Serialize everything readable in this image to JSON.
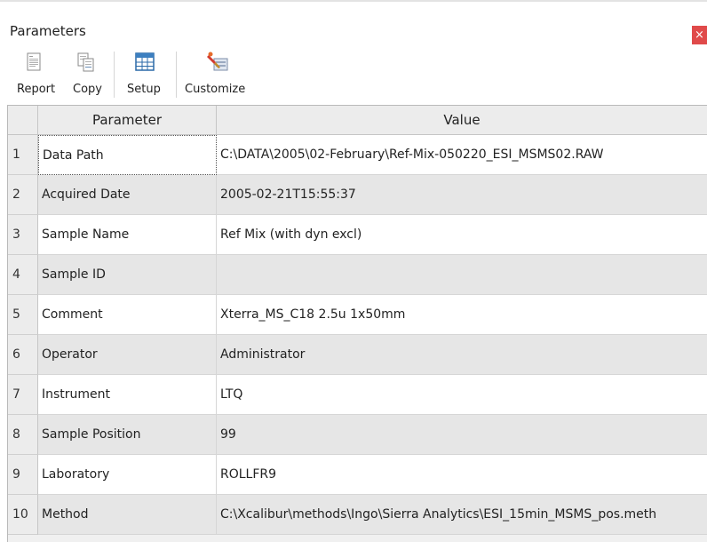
{
  "window": {
    "title": "Parameters",
    "close_label": "×"
  },
  "toolbar": {
    "items": [
      {
        "label": "Report",
        "icon": "report-icon"
      },
      {
        "label": "Copy",
        "icon": "copy-icon"
      },
      {
        "label": "Setup",
        "icon": "setup-icon"
      },
      {
        "label": "Customize",
        "icon": "customize-icon"
      }
    ]
  },
  "table": {
    "headers": {
      "parameter": "Parameter",
      "value": "Value"
    },
    "rows": [
      {
        "num": "1",
        "parameter": "Data Path",
        "value": "C:\\DATA\\2005\\02-February\\Ref-Mix-050220_ESI_MSMS02.RAW"
      },
      {
        "num": "2",
        "parameter": "Acquired Date",
        "value": "2005-02-21T15:55:37"
      },
      {
        "num": "3",
        "parameter": "Sample Name",
        "value": "Ref Mix (with dyn excl)"
      },
      {
        "num": "4",
        "parameter": "Sample ID",
        "value": ""
      },
      {
        "num": "5",
        "parameter": "Comment",
        "value": "Xterra_MS_C18 2.5u 1x50mm"
      },
      {
        "num": "6",
        "parameter": "Operator",
        "value": "Administrator"
      },
      {
        "num": "7",
        "parameter": "Instrument",
        "value": "LTQ"
      },
      {
        "num": "8",
        "parameter": "Sample Position",
        "value": "99"
      },
      {
        "num": "9",
        "parameter": "Laboratory",
        "value": "ROLLFR9"
      },
      {
        "num": "10",
        "parameter": "Method",
        "value": "C:\\Xcalibur\\methods\\Ingo\\Sierra Analytics\\ESI_15min_MSMS_pos.meth"
      }
    ]
  }
}
